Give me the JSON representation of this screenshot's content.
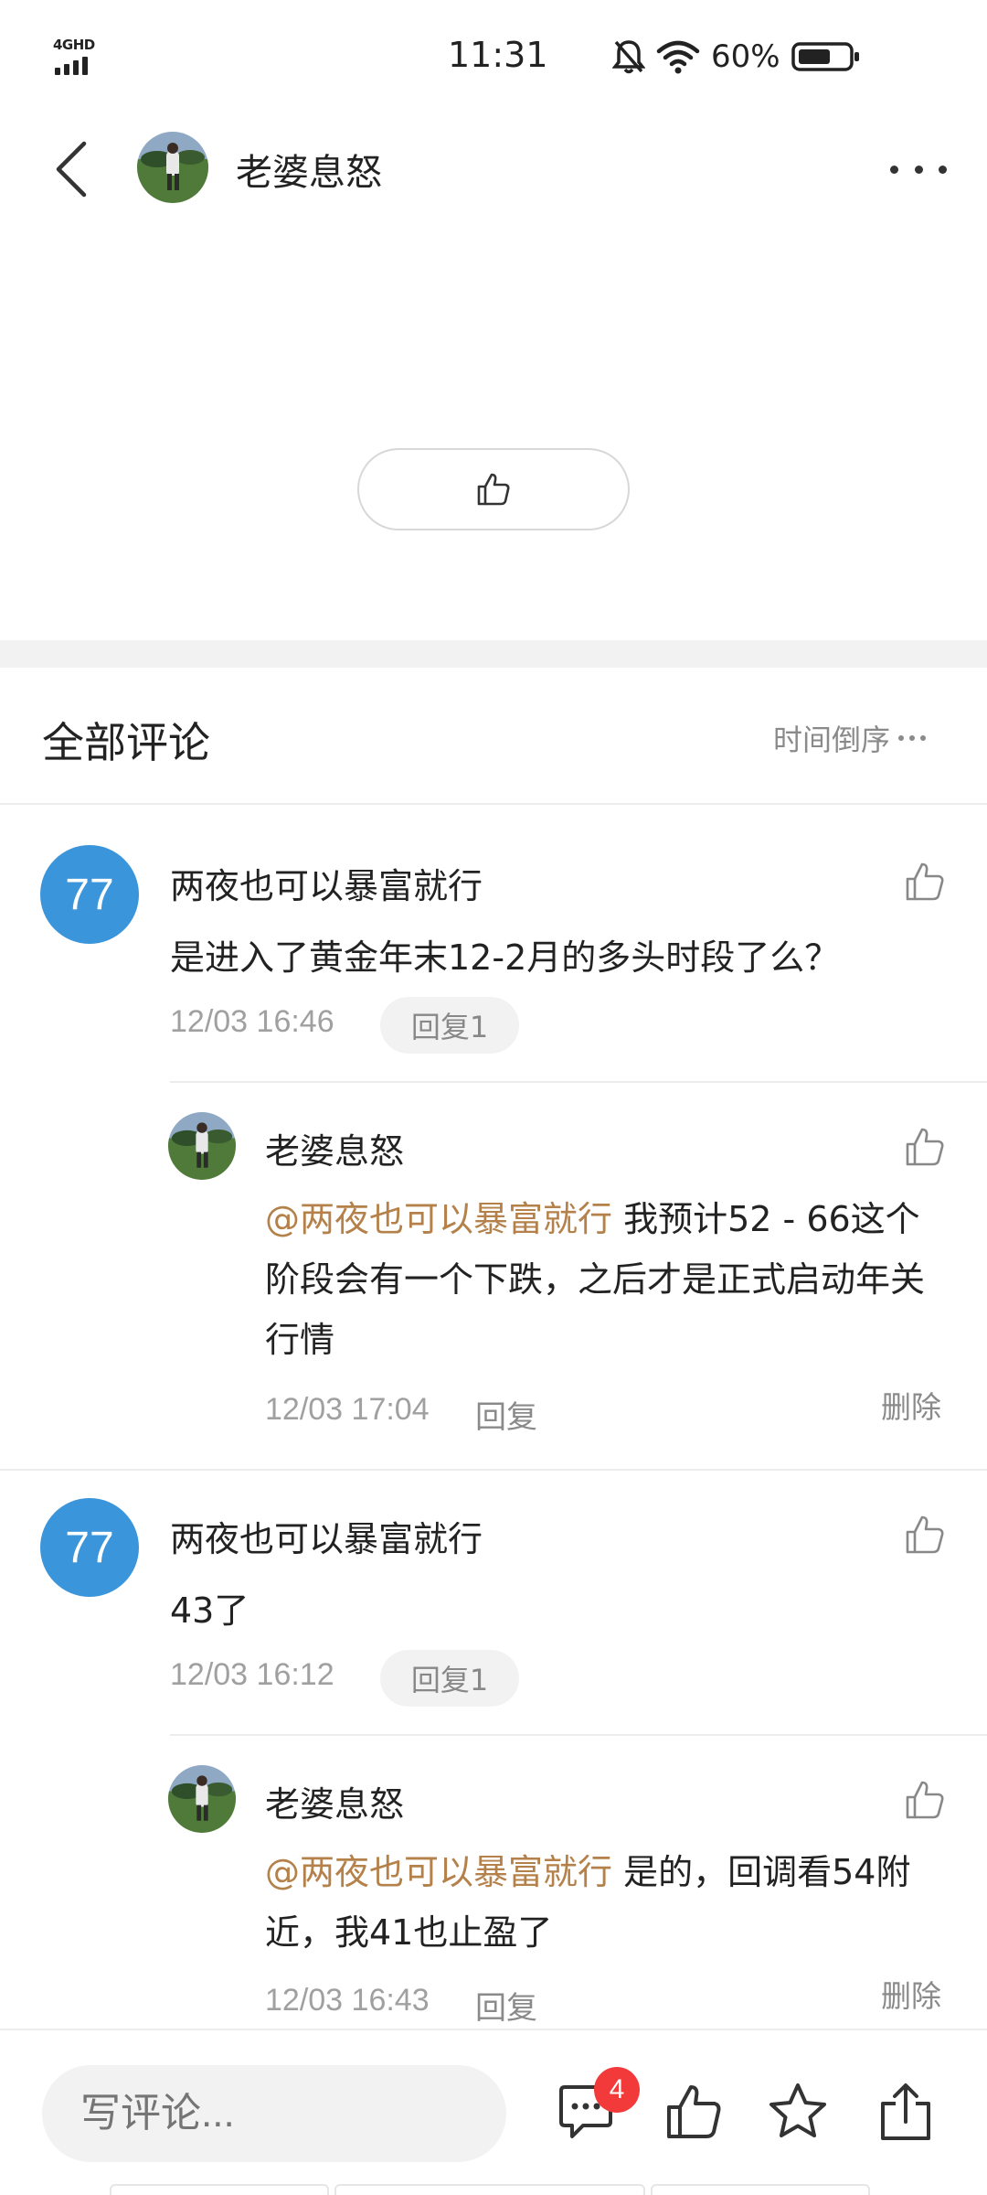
{
  "status_bar": {
    "network": "4GHD",
    "time": "11:31",
    "battery": "60%",
    "icons": [
      "bell-muted-icon",
      "wifi-icon",
      "battery-icon"
    ]
  },
  "header": {
    "user_name": "老婆息怒",
    "icons": [
      "back-arrow-icon",
      "more-dots-icon"
    ]
  },
  "comments_section": {
    "title": "全部评论",
    "sort_label": "时间倒序"
  },
  "comments": [
    {
      "avatar_text": "77",
      "author": "两夜也可以暴富就行",
      "text": "是进入了黄金年末12-2月的多头时段了么？",
      "time": "12/03 16:46",
      "reply_label": "回复1",
      "reply": {
        "author": "老婆息怒",
        "mention": "@两夜也可以暴富就行",
        "text": " 我预计52 - 66这个阶段会有一个下跌，之后才是正式启动年关行情",
        "time": "12/03 17:04",
        "reply_label": "回复",
        "delete_label": "删除"
      }
    },
    {
      "avatar_text": "77",
      "author": "两夜也可以暴富就行",
      "text": "43了",
      "time": "12/03 16:12",
      "reply_label": "回复1",
      "reply": {
        "author": "老婆息怒",
        "mention": "@两夜也可以暴富就行",
        "text": " 是的，回调看54附近，我41也止盈了",
        "time": "12/03 16:43",
        "reply_label": "回复",
        "delete_label": "删除"
      }
    }
  ],
  "bottom_bar": {
    "input_placeholder": "写评论...",
    "comment_count": "4",
    "icons": [
      "comment-icon",
      "like-icon",
      "favorite-star-icon",
      "share-icon"
    ]
  },
  "colors": {
    "avatar_blue": "#3b95db",
    "mention": "#b5814a",
    "badge_red": "#f23a3a"
  }
}
